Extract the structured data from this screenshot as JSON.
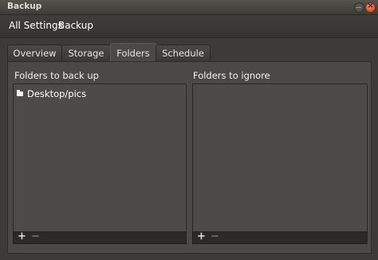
{
  "window": {
    "title": "Backup"
  },
  "breadcrumbs": [
    {
      "label": "All Settings"
    },
    {
      "label": "Backup"
    }
  ],
  "tabs": [
    {
      "label": "Overview"
    },
    {
      "label": "Storage"
    },
    {
      "label": "Folders"
    },
    {
      "label": "Schedule"
    }
  ],
  "active_tab": "Folders",
  "folders_to_back_up": {
    "label": "Folders to back up",
    "items": [
      {
        "icon": "folder-icon",
        "name": "Desktop/pics"
      }
    ],
    "add_label": "+",
    "remove_label": "−"
  },
  "folders_to_ignore": {
    "label": "Folders to ignore",
    "items": [],
    "add_label": "+",
    "remove_label": "−"
  }
}
